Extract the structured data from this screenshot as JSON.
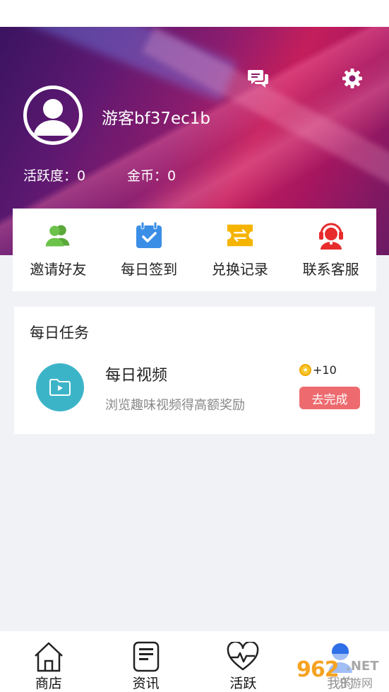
{
  "header": {
    "username": "游客bf37ec1b",
    "activity": "活跃度：0",
    "coins": "金币：0"
  },
  "quick_actions": [
    {
      "label": "邀请好友",
      "icon": "users-icon",
      "color": "#6cc24a"
    },
    {
      "label": "每日签到",
      "icon": "calendar-check-icon",
      "color": "#3a8ee6"
    },
    {
      "label": "兑换记录",
      "icon": "exchange-ticket-icon",
      "color": "#f5b400"
    },
    {
      "label": "联系客服",
      "icon": "customer-service-icon",
      "color": "#e82c2c"
    }
  ],
  "tasks": {
    "title": "每日任务",
    "items": [
      {
        "name": "每日视频",
        "description": "浏览趣味视频得高额奖励",
        "reward": "+10",
        "action": "去完成",
        "icon": "video-folder-icon"
      }
    ]
  },
  "tabbar": [
    {
      "label": "商店",
      "icon": "home-icon"
    },
    {
      "label": "资讯",
      "icon": "news-icon"
    },
    {
      "label": "活跃",
      "icon": "heart-pulse-icon"
    },
    {
      "label": "我的",
      "icon": "user-icon",
      "active": true
    }
  ],
  "watermark": {
    "brand": "962",
    "net": ".NET",
    "sub": "乐游网"
  },
  "colors": {
    "accent_red": "#ed6b6f",
    "task_icon_bg": "#3cb4c8",
    "active_tab": "#2f6fe8"
  }
}
